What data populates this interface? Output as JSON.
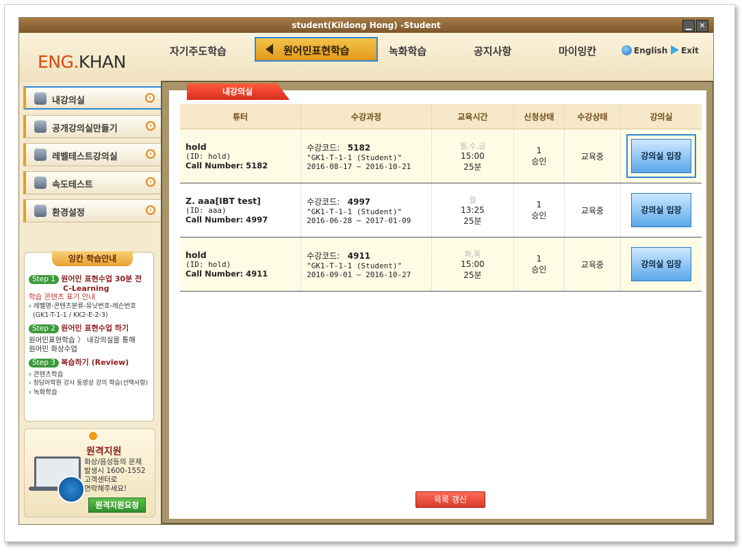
{
  "window": {
    "title": "student(Kildong Hong) -Student"
  },
  "logo": {
    "part1": "ENG.",
    "part2": "KHAN"
  },
  "nav": {
    "items": [
      "자기주도학습",
      "원어민표현학습",
      "녹화학습",
      "공지사항",
      "마이잉칸"
    ],
    "english": "English",
    "exit": "Exit"
  },
  "sidebar": {
    "items": [
      {
        "label": "내강의실",
        "icon": "webcam-icon"
      },
      {
        "label": "공개강의실만들기",
        "icon": "classroom-icon"
      },
      {
        "label": "레벨테스트강의실",
        "icon": "computer-icon"
      },
      {
        "label": "속도테스트",
        "icon": "chart-icon"
      },
      {
        "label": "환경설정",
        "icon": "gear-icon"
      }
    ]
  },
  "guide": {
    "title": "잉칸 학습안내",
    "step1_badge": "Step 1",
    "step1_title": "원어민 표현수업 30분 전",
    "step1_sub": "C-Learning",
    "step1_note": "학습 콘텐츠 표기 안내",
    "step1_detail": "› 레벨명-콘텐츠분류-유닛번호-레슨번호",
    "step1_example": "(GK1-T-1-1 / KK2-E-2-3)",
    "step2_badge": "Step 2",
    "step2_title": "원어민 표현수업 하기",
    "step2_line1": "원어민표현학습 〉 내강의실을 통해",
    "step2_line2": "원어민 화상수업",
    "step3_badge": "Step 3",
    "step3_title": "복습하기 (Review)",
    "step3_item1": "› 콘텐츠학습",
    "step3_item2": "› 청담어학원 강사 동영상 강의 학습(선택사항)",
    "step3_item3": "› 녹화학습"
  },
  "remote": {
    "title": "원격지원",
    "line1": "화상/음성등의 문제",
    "line2": "발생시 1600-1552",
    "line3": "고객센터로",
    "line4": "연락해주세요!",
    "button": "원격지원요청"
  },
  "tab": {
    "label": "내강의실"
  },
  "table": {
    "headers": [
      "튜터",
      "수강과정",
      "교육시간",
      "신청상태",
      "수강상태",
      "강의실"
    ],
    "rows": [
      {
        "tutor": "hold",
        "id": "(ID: hold)",
        "call": "Call Number: 5182",
        "code_label": "수강코드:",
        "code": "5182",
        "course": "\"GK1-T-1-1 (Student)\"",
        "period": "2016-08-17 ~ 2016-10-21",
        "days": "월,수,금",
        "time": "15:00",
        "duration": "25분",
        "apply_count": "1",
        "apply_status": "승인",
        "status": "교육중",
        "button": "강의실 입장"
      },
      {
        "tutor": "Z. aaa[IBT test]",
        "id": "(ID: aaa)",
        "call": "Call Number: 4997",
        "code_label": "수강코드:",
        "code": "4997",
        "course": "\"GK1-T-1-1 (Student)\"",
        "period": "2016-06-28 ~ 2017-01-09",
        "days": "월",
        "time": "13:25",
        "duration": "25분",
        "apply_count": "1",
        "apply_status": "승인",
        "status": "교육중",
        "button": "강의실 입장"
      },
      {
        "tutor": "hold",
        "id": "(ID: hold)",
        "call": "Call Number: 4911",
        "code_label": "수강코드:",
        "code": "4911",
        "course": "\"GK1-T-1-1 (Student)\"",
        "period": "2016-09-01 ~ 2016-10-27",
        "days": "화,목",
        "time": "15:00",
        "duration": "25분",
        "apply_count": "1",
        "apply_status": "승인",
        "status": "교육중",
        "button": "강의실 입장"
      }
    ]
  },
  "refresh_button": "목록 갱신",
  "colors": {
    "accent": "#e39a1b",
    "highlight": "#2e86d6",
    "logo": "#d44a13"
  }
}
